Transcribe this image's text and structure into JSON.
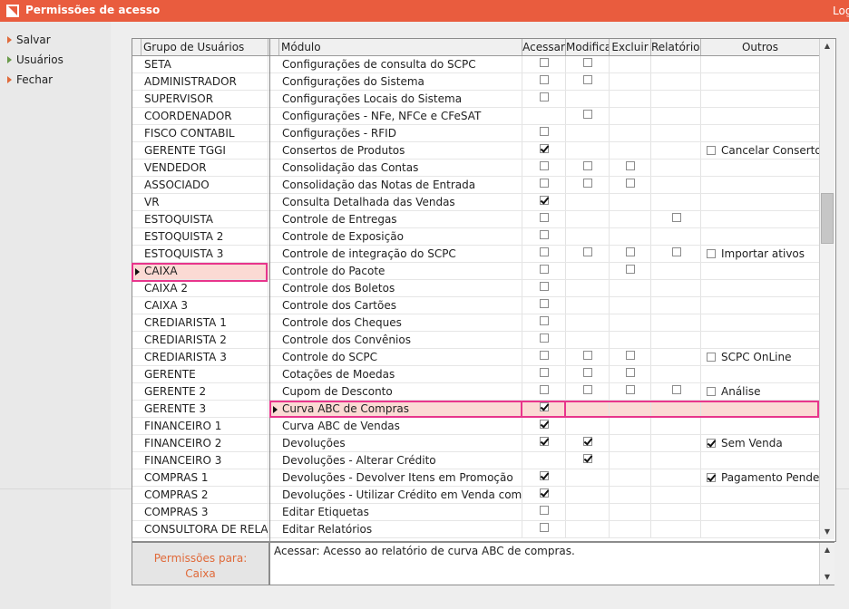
{
  "window": {
    "title": "Permissões de acesso",
    "login_label": "Log"
  },
  "sidebar": {
    "items": [
      {
        "label": "Salvar"
      },
      {
        "label": "Usuários"
      },
      {
        "label": "Fechar"
      }
    ]
  },
  "groups": {
    "header": "Grupo de Usuários",
    "selected_index": 12,
    "items": [
      "SETA",
      "ADMINISTRADOR",
      "SUPERVISOR",
      "COORDENADOR",
      "FISCO CONTABIL",
      "GERENTE TGGI",
      "VENDEDOR",
      "ASSOCIADO",
      "VR",
      "ESTOQUISTA",
      "ESTOQUISTA 2",
      "ESTOQUISTA 3",
      "CAIXA",
      "CAIXA 2",
      "CAIXA 3",
      "CREDIARISTA 1",
      "CREDIARISTA 2",
      "CREDIARISTA 3",
      "GERENTE",
      "GERENTE 2",
      "GERENTE 3",
      "FINANCEIRO 1",
      "FINANCEIRO 2",
      "FINANCEIRO 3",
      "COMPRAS 1",
      "COMPRAS 2",
      "COMPRAS 3",
      "CONSULTORA DE RELACIONAMENTO"
    ]
  },
  "modules": {
    "headers": {
      "modulo": "Módulo",
      "acessar": "Acessar",
      "modificar": "Modificar",
      "excluir": "Excluir",
      "relatorios": "Relatórios",
      "outros": "Outros"
    },
    "selected_index": 20,
    "rows": [
      {
        "name": "Configurações de consulta do SCPC",
        "acessar": false,
        "modificar": false,
        "excluir": null,
        "relatorios": null
      },
      {
        "name": "Configurações do Sistema",
        "acessar": false,
        "modificar": false,
        "excluir": null,
        "relatorios": null
      },
      {
        "name": "Configurações Locais do Sistema",
        "acessar": false,
        "modificar": null,
        "excluir": null,
        "relatorios": null
      },
      {
        "name": "Configurações - NFe, NFCe e CFeSAT",
        "acessar": null,
        "modificar": false,
        "excluir": null,
        "relatorios": null
      },
      {
        "name": "Configurações - RFID",
        "acessar": false,
        "modificar": null,
        "excluir": null,
        "relatorios": null
      },
      {
        "name": "Consertos de Produtos",
        "acessar": true,
        "modificar": null,
        "excluir": null,
        "relatorios": null,
        "outros": {
          "label": "Cancelar Conserto",
          "checked": false
        }
      },
      {
        "name": "Consolidação das Contas",
        "acessar": false,
        "modificar": false,
        "excluir": false,
        "relatorios": null
      },
      {
        "name": "Consolidação das Notas de Entrada",
        "acessar": false,
        "modificar": false,
        "excluir": false,
        "relatorios": null
      },
      {
        "name": "Consulta Detalhada das Vendas",
        "acessar": true,
        "modificar": null,
        "excluir": null,
        "relatorios": null
      },
      {
        "name": "Controle de Entregas",
        "acessar": false,
        "modificar": null,
        "excluir": null,
        "relatorios": false
      },
      {
        "name": "Controle de Exposição",
        "acessar": false,
        "modificar": null,
        "excluir": null,
        "relatorios": null
      },
      {
        "name": "Controle de integração do SCPC",
        "acessar": false,
        "modificar": false,
        "excluir": false,
        "relatorios": false,
        "outros": {
          "label": "Importar ativos",
          "checked": false
        }
      },
      {
        "name": "Controle do Pacote",
        "acessar": false,
        "modificar": null,
        "excluir": false,
        "relatorios": null
      },
      {
        "name": "Controle dos Boletos",
        "acessar": false,
        "modificar": null,
        "excluir": null,
        "relatorios": null
      },
      {
        "name": "Controle dos Cartões",
        "acessar": false,
        "modificar": null,
        "excluir": null,
        "relatorios": null
      },
      {
        "name": "Controle dos Cheques",
        "acessar": false,
        "modificar": null,
        "excluir": null,
        "relatorios": null
      },
      {
        "name": "Controle dos Convênios",
        "acessar": false,
        "modificar": null,
        "excluir": null,
        "relatorios": null
      },
      {
        "name": "Controle do SCPC",
        "acessar": false,
        "modificar": false,
        "excluir": false,
        "relatorios": null,
        "outros": {
          "label": "SCPC OnLine",
          "checked": false
        }
      },
      {
        "name": "Cotações de Moedas",
        "acessar": false,
        "modificar": false,
        "excluir": false,
        "relatorios": null
      },
      {
        "name": "Cupom de Desconto",
        "acessar": false,
        "modificar": false,
        "excluir": false,
        "relatorios": false,
        "outros": {
          "label": "Análise",
          "checked": false
        }
      },
      {
        "name": "Curva ABC de Compras",
        "acessar": true,
        "modificar": null,
        "excluir": null,
        "relatorios": null
      },
      {
        "name": "Curva ABC de Vendas",
        "acessar": true,
        "modificar": null,
        "excluir": null,
        "relatorios": null
      },
      {
        "name": "Devoluções",
        "acessar": true,
        "modificar": true,
        "excluir": null,
        "relatorios": null,
        "outros": {
          "label": "Sem Venda",
          "checked": true
        }
      },
      {
        "name": "Devoluções - Alterar Crédito",
        "acessar": null,
        "modificar": true,
        "excluir": null,
        "relatorios": null
      },
      {
        "name": "Devoluções - Devolver Itens em Promoção",
        "acessar": true,
        "modificar": null,
        "excluir": null,
        "relatorios": null,
        "outros": {
          "label": "Pagamento Pendente",
          "checked": true
        }
      },
      {
        "name": "Devoluções - Utilizar Crédito em Venda com Desconto",
        "acessar": true,
        "modificar": null,
        "excluir": null,
        "relatorios": null
      },
      {
        "name": "Editar Etiquetas",
        "acessar": false,
        "modificar": null,
        "excluir": null,
        "relatorios": null
      },
      {
        "name": "Editar Relatórios",
        "acessar": false,
        "modificar": null,
        "excluir": null,
        "relatorios": null
      }
    ]
  },
  "footer": {
    "permissions_label": "Permissões para:",
    "permissions_group": "Caixa",
    "description": "Acessar: Acesso ao relatório de curva ABC de compras."
  },
  "colors": {
    "titlebar": "#e95c3e",
    "accent": "#e06a3a",
    "highlight": "#e8358c",
    "selected_row": "#fbdad4"
  },
  "icons": {
    "logo": "app-logo-icon",
    "sidebar_item": "triangle-right-icon",
    "row_pointer": "row-pointer-icon",
    "scroll_up": "chevron-up-icon",
    "scroll_down": "chevron-down-icon"
  }
}
